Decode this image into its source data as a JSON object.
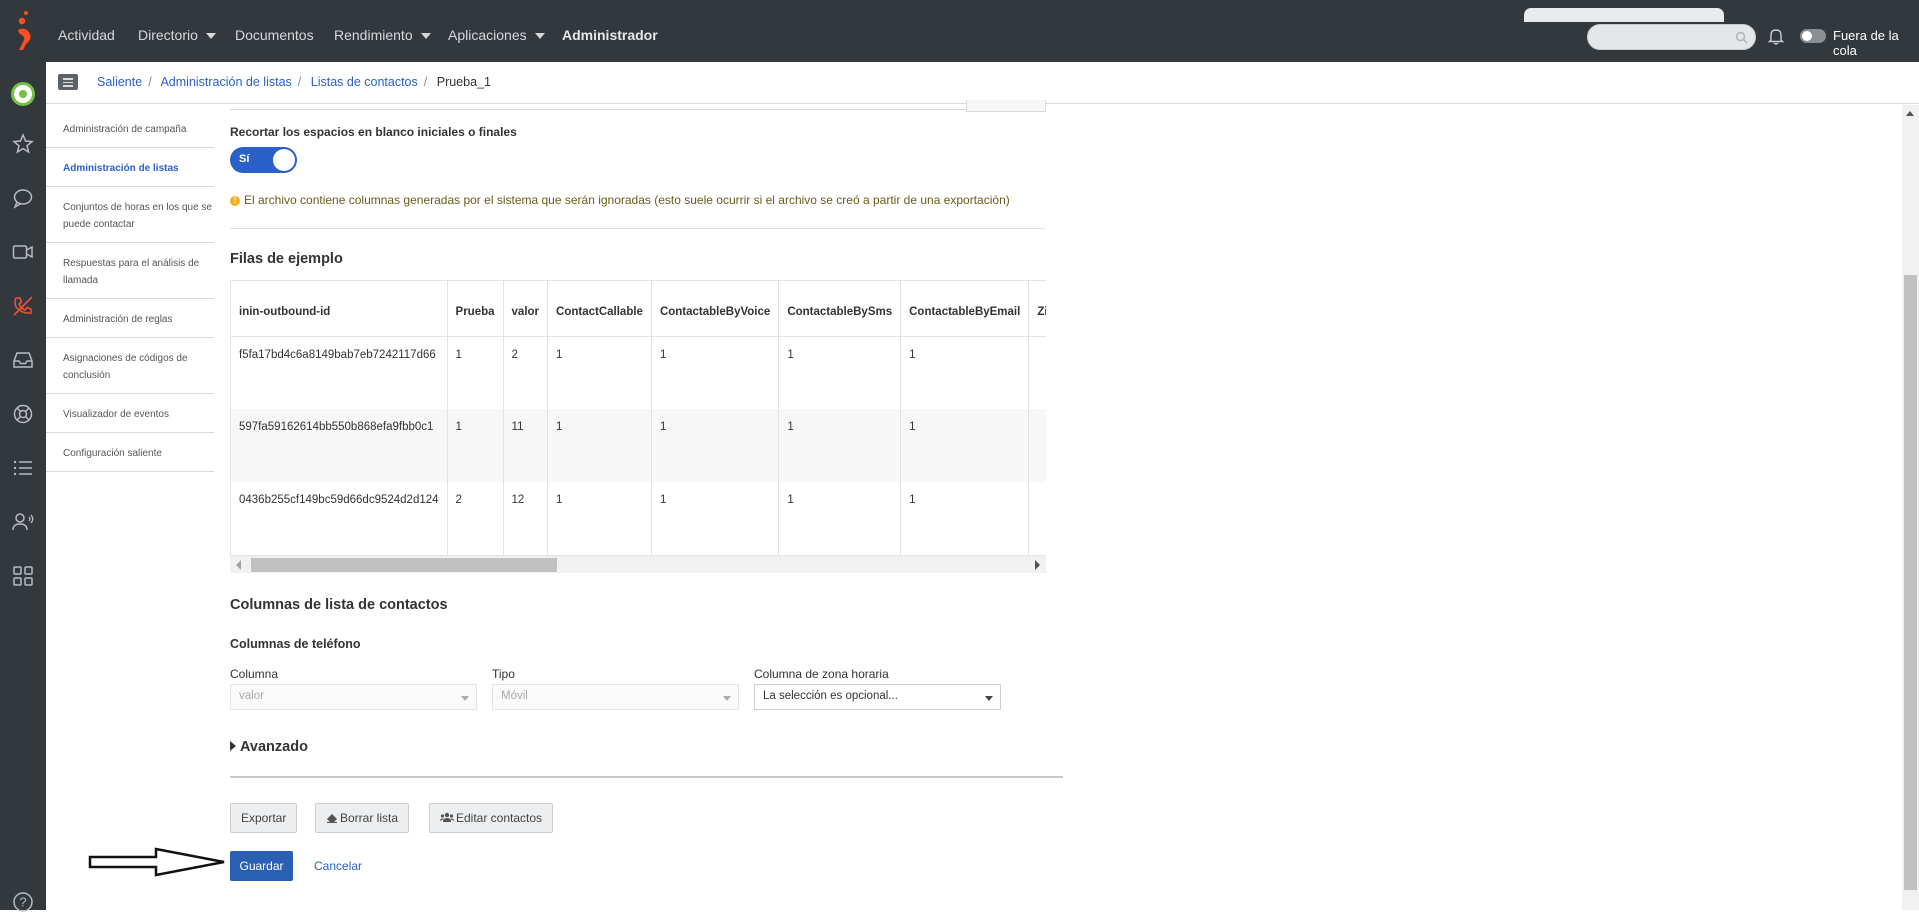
{
  "topbar": {
    "nav": [
      {
        "label": "Actividad",
        "caret": false
      },
      {
        "label": "Directorio",
        "caret": true
      },
      {
        "label": "Documentos",
        "caret": false
      },
      {
        "label": "Rendimiento",
        "caret": true
      },
      {
        "label": "Aplicaciones",
        "caret": true
      },
      {
        "label": "Administrador",
        "caret": false
      }
    ],
    "queue_label": "Fuera de la cola"
  },
  "breadcrumb": [
    "Saliente",
    "Administración de listas",
    "Listas de contactos",
    "Prueba_1"
  ],
  "side_menu": [
    "Administración de campaña",
    "Administración de listas",
    "Conjuntos de horas en los que se puede contactar",
    "Respuestas para el análisis de llamada",
    "Administración de reglas",
    "Asignaciones de códigos de conclusión",
    "Visualizador de eventos",
    "Configuración saliente"
  ],
  "trim": {
    "label": "Recortar los espacios en blanco iniciales o finales",
    "value": "Sí"
  },
  "warning": "El archivo contiene columnas generadas por el sistema que serán ignoradas (esto suele ocurrir si el archivo se creó a partir de una exportación)",
  "sample": {
    "title": "Filas de ejemplo",
    "columns": [
      "inin-outbound-id",
      "Prueba",
      "valor",
      "ContactCallable",
      "ContactableByVoice",
      "ContactableBySms",
      "ContactableByEmail",
      "Zip("
    ],
    "rows": [
      [
        "f5fa17bd4c6a8149bab7eb7242117d66",
        "1",
        "2",
        "1",
        "1",
        "1",
        "1",
        ""
      ],
      [
        "597fa59162614bb550b868efa9fbb0c1",
        "1",
        "11",
        "1",
        "1",
        "1",
        "1",
        ""
      ],
      [
        "0436b255cf149bc59d66dc9524d2d124",
        "2",
        "12",
        "1",
        "1",
        "1",
        "1",
        ""
      ]
    ]
  },
  "contact_columns": {
    "title": "Columnas de lista de contactos",
    "phone_title": "Columnas de teléfono",
    "column_label": "Columna",
    "column_value": "valor",
    "type_label": "Tipo",
    "type_value": "Móvil",
    "tz_label": "Columna de zona horaria",
    "tz_value": "La selección es opcional..."
  },
  "advanced": "Avanzado",
  "buttons": {
    "export": "Exportar",
    "clear": "Borrar lista",
    "edit": "Editar contactos",
    "save": "Guardar",
    "cancel": "Cancelar"
  },
  "colors": {
    "topbar": "#33383d",
    "accent": "#2a60c8",
    "logo": "#ff4f1f",
    "presence": "#74c043"
  }
}
